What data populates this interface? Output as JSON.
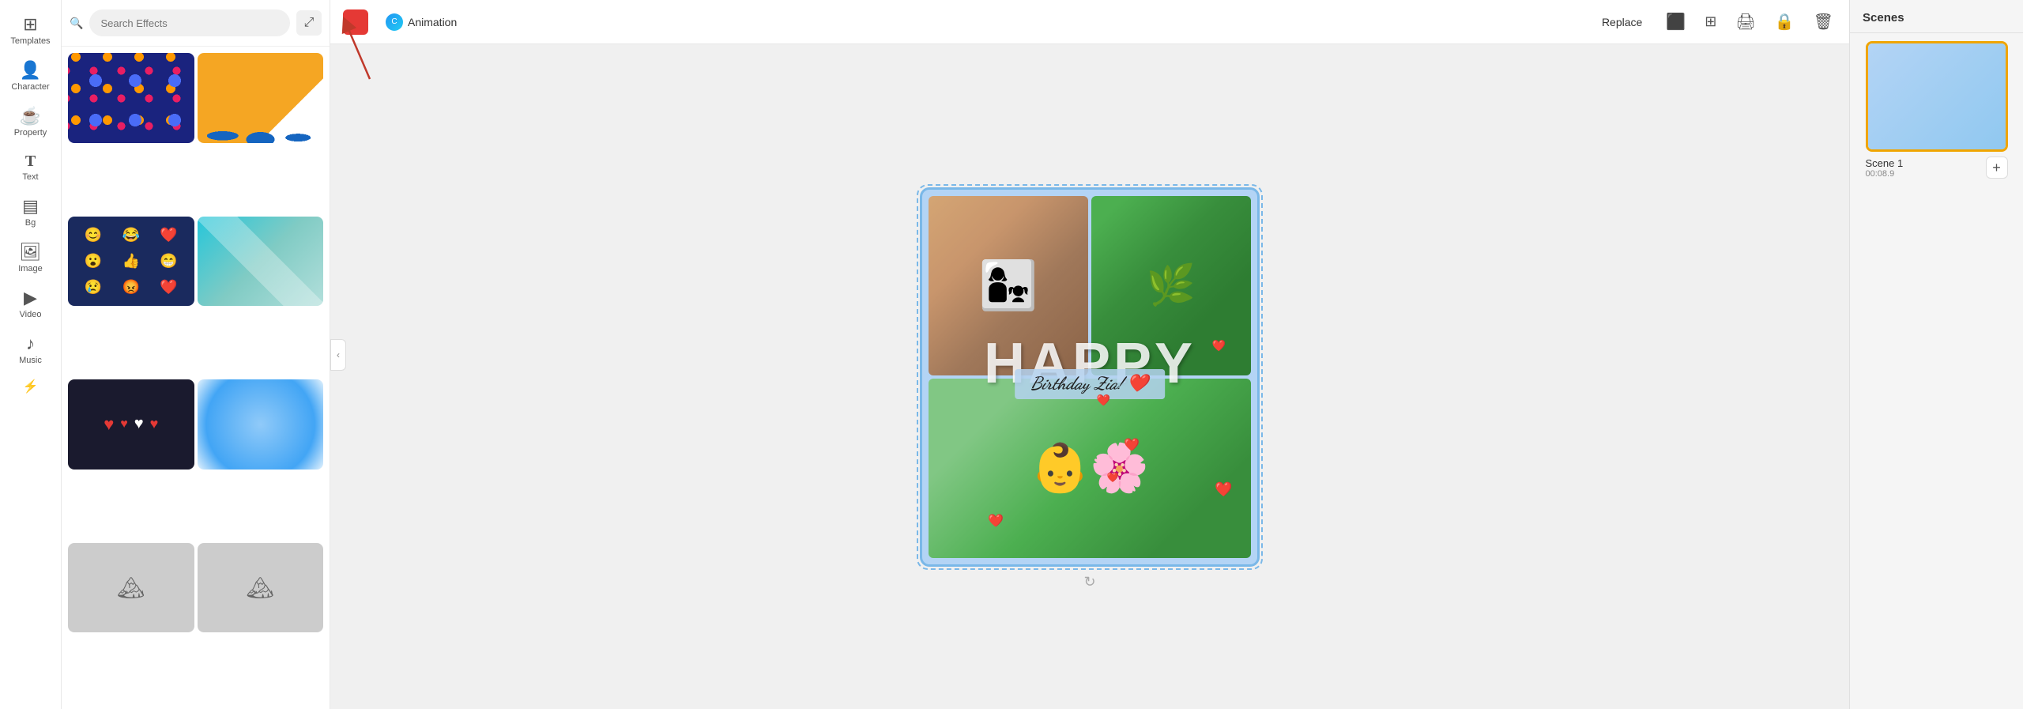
{
  "sidebar": {
    "items": [
      {
        "id": "templates",
        "label": "Templates",
        "icon": "⊞"
      },
      {
        "id": "character",
        "label": "Character",
        "icon": "👤"
      },
      {
        "id": "property",
        "label": "Property",
        "icon": "☕"
      },
      {
        "id": "text",
        "label": "Text",
        "icon": "T"
      },
      {
        "id": "bg",
        "label": "Bg",
        "icon": "▤"
      },
      {
        "id": "image",
        "label": "Image",
        "icon": "🖼"
      },
      {
        "id": "video",
        "label": "Video",
        "icon": "▶"
      },
      {
        "id": "music",
        "label": "Music",
        "icon": "♪"
      },
      {
        "id": "more",
        "label": "...",
        "icon": "⚡"
      }
    ]
  },
  "search": {
    "placeholder": "Search Effects"
  },
  "toolbar": {
    "animation_label": "Animation",
    "replace_label": "Replace"
  },
  "scenes": {
    "header": "Scenes",
    "items": [
      {
        "name": "Scene 1",
        "time": "00:08.9"
      }
    ],
    "add_label": "+"
  },
  "canvas": {
    "birthday_text": "Birthday Zia! ❤️",
    "happy_text": "HAPPY"
  },
  "colors": {
    "swatch": "#e53935",
    "animation_gradient_start": "#2196f3",
    "animation_gradient_end": "#21cbf3",
    "scene_border": "#f0a500"
  }
}
